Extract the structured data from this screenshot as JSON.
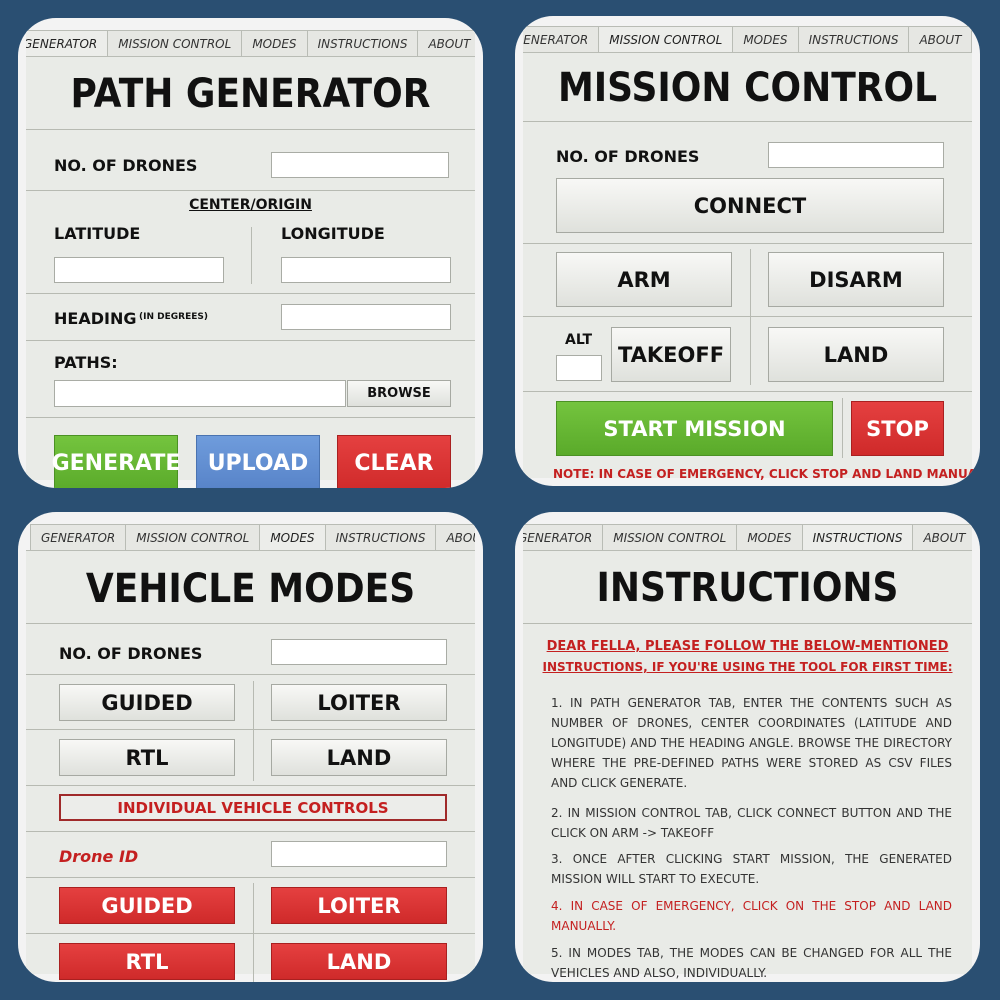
{
  "tabs": [
    "GENERATOR",
    "MISSION CONTROL",
    "MODES",
    "INSTRUCTIONS",
    "ABOUT"
  ],
  "generator": {
    "title": "PATH GENERATOR",
    "drones_label": "NO. OF DRONES",
    "center_label": "CENTER/ORIGIN",
    "latitude_label": "LATITUDE",
    "longitude_label": "LONGITUDE",
    "heading_label": "HEADING",
    "heading_unit": "(IN DEGREES)",
    "paths_label": "PATHS:",
    "browse": "BROWSE",
    "generate": "GENERATE",
    "upload": "UPLOAD",
    "clear": "CLEAR"
  },
  "mission": {
    "title": "MISSION CONTROL",
    "drones_label": "NO. OF DRONES",
    "connect": "CONNECT",
    "arm": "ARM",
    "disarm": "DISARM",
    "alt_label": "ALT",
    "takeoff": "TAKEOFF",
    "land": "LAND",
    "start": "START MISSION",
    "stop": "STOP",
    "note": "NOTE: IN CASE OF EMERGENCY, CLICK STOP AND LAND MANUALLY"
  },
  "modes": {
    "title": "VEHICLE MODES",
    "drones_label": "NO. OF DRONES",
    "guided": "GUIDED",
    "loiter": "LOITER",
    "rtl": "RTL",
    "land": "LAND",
    "individual": "INDIVIDUAL VEHICLE CONTROLS",
    "drone_id_label": "Drone ID",
    "guided2": "GUIDED",
    "loiter2": "LOITER",
    "rtl2": "RTL",
    "land2": "LAND"
  },
  "instructions": {
    "title": "INSTRUCTIONS",
    "head1": "DEAR FELLA, PLEASE FOLLOW THE BELOW-MENTIONED",
    "head2": "INSTRUCTIONS, IF YOU'RE USING THE TOOL FOR FIRST TIME:",
    "p1": "1. IN PATH GENERATOR TAB, ENTER THE CONTENTS SUCH AS NUMBER OF DRONES, CENTER COORDINATES (LATITUDE AND LONGITUDE) AND THE HEADING ANGLE. BROWSE THE DIRECTORY WHERE THE PRE-DEFINED PATHS WERE STORED AS CSV FILES AND CLICK GENERATE.",
    "p2": "2. IN MISSION CONTROL TAB, CLICK CONNECT BUTTON AND THE CLICK ON ARM -> TAKEOFF",
    "p3": "3. ONCE AFTER CLICKING START MISSION, THE GENERATED MISSION WILL START TO EXECUTE.",
    "p4": "4. IN CASE OF EMERGENCY, CLICK ON THE STOP AND LAND MANUALLY.",
    "p5": "5. IN MODES TAB, THE MODES CAN BE CHANGED FOR ALL THE VEHICLES AND ALSO, INDIVIDUALLY."
  },
  "colors": {
    "background": "#2a4f72",
    "green": "#5aaa2a",
    "blue": "#5783c8",
    "red": "#cf2a2a",
    "note_red": "#c42020"
  }
}
